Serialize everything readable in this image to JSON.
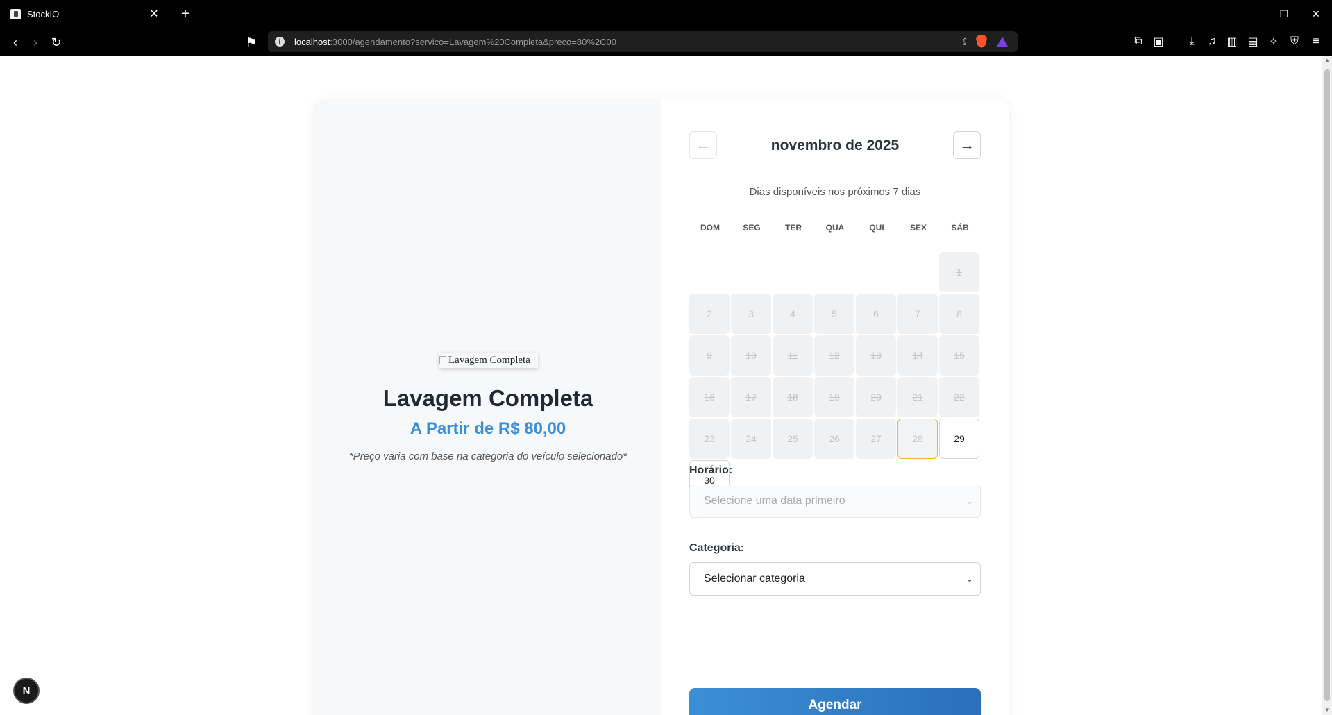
{
  "browser": {
    "tab_title": "StockIO",
    "url_host": "localhost",
    "url_rest": ":3000/agendamento?servico=Lavagem%20Completa&preco=80%2C00"
  },
  "service": {
    "image_alt": "Lavagem Completa",
    "title": "Lavagem Completa",
    "price": "A Partir de R$ 80,00",
    "note": "*Preço varia com base na categoria do veículo selecionado*"
  },
  "calendar": {
    "month": "novembro de 2025",
    "subtitle": "Dias disponíveis nos próximos 7 dias",
    "prev": "←",
    "next": "→",
    "weekdays": [
      "DOM",
      "SEG",
      "TER",
      "QUA",
      "QUI",
      "SEX",
      "SÁB"
    ],
    "leading_empty": 6,
    "days": [
      {
        "n": "1",
        "state": "off"
      },
      {
        "n": "2",
        "state": "off"
      },
      {
        "n": "3",
        "state": "off"
      },
      {
        "n": "4",
        "state": "off"
      },
      {
        "n": "5",
        "state": "off"
      },
      {
        "n": "6",
        "state": "off"
      },
      {
        "n": "7",
        "state": "off"
      },
      {
        "n": "8",
        "state": "off"
      },
      {
        "n": "9",
        "state": "off"
      },
      {
        "n": "10",
        "state": "off"
      },
      {
        "n": "11",
        "state": "off"
      },
      {
        "n": "12",
        "state": "off"
      },
      {
        "n": "13",
        "state": "off"
      },
      {
        "n": "14",
        "state": "off"
      },
      {
        "n": "15",
        "state": "off"
      },
      {
        "n": "16",
        "state": "off"
      },
      {
        "n": "17",
        "state": "off"
      },
      {
        "n": "18",
        "state": "off"
      },
      {
        "n": "19",
        "state": "off"
      },
      {
        "n": "20",
        "state": "off"
      },
      {
        "n": "21",
        "state": "off"
      },
      {
        "n": "22",
        "state": "off"
      },
      {
        "n": "23",
        "state": "off"
      },
      {
        "n": "24",
        "state": "off"
      },
      {
        "n": "25",
        "state": "off"
      },
      {
        "n": "26",
        "state": "off"
      },
      {
        "n": "27",
        "state": "off"
      },
      {
        "n": "28",
        "state": "today"
      },
      {
        "n": "29",
        "state": "on"
      },
      {
        "n": "30",
        "state": "on"
      }
    ]
  },
  "form": {
    "time_label": "Horário:",
    "time_placeholder": "Selecione uma data primeiro",
    "category_label": "Categoria:",
    "category_value": "Selecionar categoria",
    "submit_label": "Agendar"
  },
  "dev_badge": "N",
  "colors": {
    "accent": "#3b8fd6",
    "today_border": "#f0b429"
  }
}
